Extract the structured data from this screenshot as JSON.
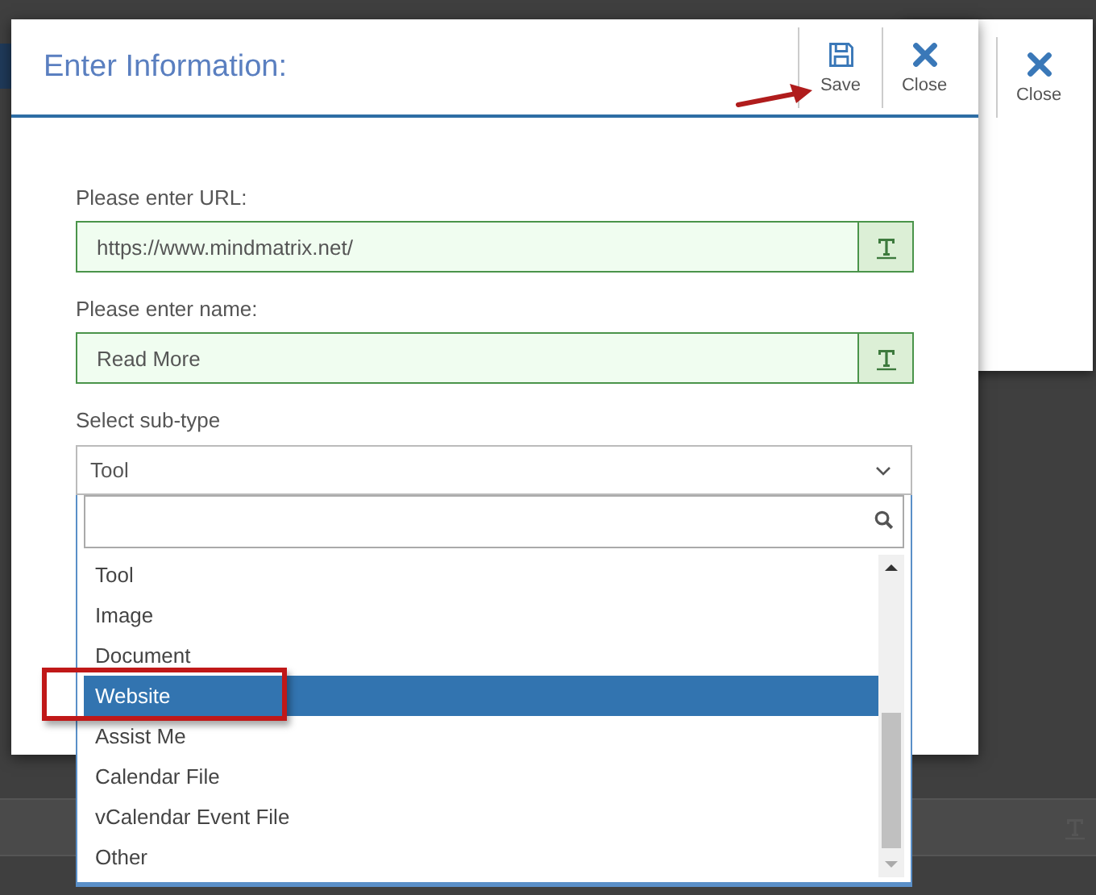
{
  "back_dialog": {
    "buttons": [
      {
        "label": "Close",
        "kind": "close"
      }
    ]
  },
  "dialog": {
    "title": "Enter Information:",
    "buttons": [
      {
        "label": "Save",
        "kind": "save"
      },
      {
        "label": "Close",
        "kind": "close"
      }
    ],
    "fields": [
      {
        "label": "Please enter URL:",
        "value": "https://www.mindmatrix.net/"
      },
      {
        "label": "Please enter name:",
        "value": "Read More"
      }
    ],
    "select": {
      "label": "Select sub-type",
      "value": "Tool"
    }
  },
  "dropdown": {
    "options": [
      {
        "label": "Tool",
        "selected": false
      },
      {
        "label": "Image",
        "selected": false
      },
      {
        "label": "Document",
        "selected": false
      },
      {
        "label": "Website",
        "selected": true
      },
      {
        "label": "Assist Me",
        "selected": false
      },
      {
        "label": "Calendar File",
        "selected": false
      },
      {
        "label": "vCalendar Event File",
        "selected": false
      },
      {
        "label": "Other",
        "selected": false
      }
    ]
  }
}
